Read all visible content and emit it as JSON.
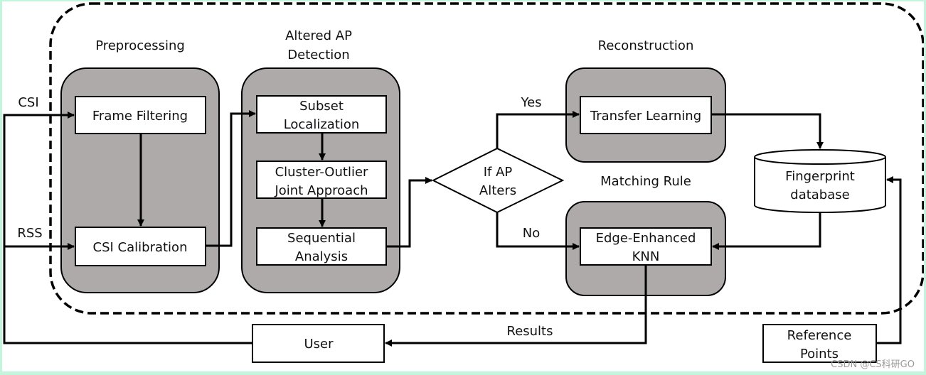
{
  "diagram": {
    "inputs": {
      "csi": "CSI",
      "rss": "RSS"
    },
    "groups": {
      "preprocessing": {
        "title": "Preprocessing"
      },
      "altered_ap": {
        "title_line1": "Altered AP",
        "title_line2": "Detection"
      },
      "reconstruction": {
        "title": "Reconstruction"
      },
      "matching": {
        "title": "Matching Rule"
      }
    },
    "nodes": {
      "frame_filtering": {
        "label": "Frame Filtering"
      },
      "csi_calibration": {
        "label": "CSI Calibration"
      },
      "subset_localization": {
        "line1": "Subset",
        "line2": "Localization"
      },
      "cluster_outlier": {
        "line1": "Cluster-Outlier",
        "line2": "Joint Approach"
      },
      "sequential_analysis": {
        "line1": "Sequential",
        "line2": "Analysis"
      },
      "decision": {
        "line1": "If AP",
        "line2": "Alters"
      },
      "transfer_learning": {
        "label": "Transfer Learning"
      },
      "edge_knn": {
        "line1": "Edge-Enhanced",
        "line2": "KNN"
      },
      "fingerprint_db": {
        "line1": "Fingerprint",
        "line2": "database"
      },
      "user": {
        "label": "User"
      },
      "reference_points": {
        "line1": "Reference",
        "line2": "Points"
      }
    },
    "edges": {
      "yes": "Yes",
      "no": "No",
      "results": "Results"
    },
    "colors": {
      "group_fill": "#aeaaa9",
      "stroke": "#000000",
      "background": "#ffffff",
      "frame": "#c3f5dd"
    }
  },
  "watermark": "CSDN @CS科研GO"
}
